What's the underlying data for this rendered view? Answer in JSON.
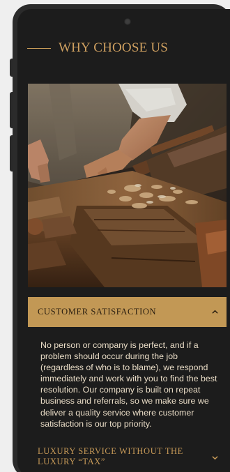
{
  "section": {
    "heading": "WHY CHOOSE US"
  },
  "accordion": {
    "items": [
      {
        "title": "CUSTOMER SATISFACTION",
        "expanded": true,
        "body": "No person or company is perfect, and if a problem should occur during the job (regardless of who is to blame), we respond immediately and work with you to find the best resolution. Our company is built on repeat business and referrals, so we make sure we deliver a quality service where customer satisfaction is our top priority."
      },
      {
        "title": "LUXURY SERVICE WITHOUT THE LUXURY “TAX”",
        "expanded": false
      }
    ]
  },
  "colors": {
    "accent": "#c29855",
    "screen_bg": "#1c1c1c",
    "body_text": "#e9dcc6"
  },
  "icons": {
    "expanded": "chevron-up-icon",
    "collapsed": "chevron-down-icon"
  }
}
